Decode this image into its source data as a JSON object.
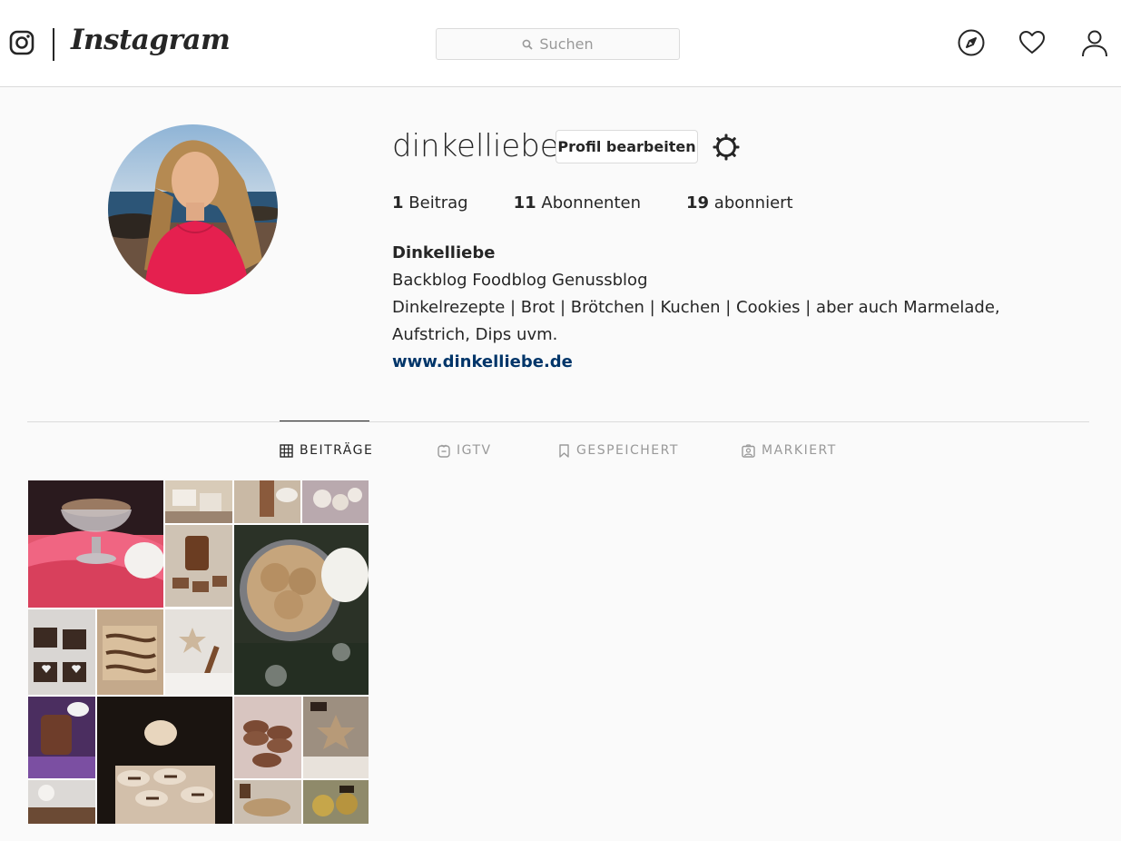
{
  "header": {
    "logo_text": "Instagram",
    "search_placeholder": "Suchen",
    "icons": [
      "instagram-glyph-icon",
      "search-icon",
      "compass-icon",
      "heart-icon",
      "person-icon"
    ]
  },
  "profile": {
    "username": "dinkelliebe",
    "edit_button": "Profil bearbeiten",
    "stats": [
      {
        "count": "1",
        "label": "Beitrag"
      },
      {
        "count": "11",
        "label": "Abonnenten"
      },
      {
        "count": "19",
        "label": "abonniert"
      }
    ],
    "full_name": "Dinkelliebe",
    "bio_line1": "Backblog Foodblog Genussblog",
    "bio_line2": "Dinkelrezepte | Brot | Brötchen | Kuchen | Cookies | aber auch Marmelade, Aufstrich, Dips uvm.",
    "website": "www.dinkelliebe.de"
  },
  "tabs": [
    {
      "label": "BEITRÄGE",
      "icon": "grid-icon",
      "active": true
    },
    {
      "label": "IGTV",
      "icon": "igtv-icon",
      "active": false
    },
    {
      "label": "GESPEICHERT",
      "icon": "bookmark-icon",
      "active": false
    },
    {
      "label": "MARKIERT",
      "icon": "tagged-icon",
      "active": false
    }
  ],
  "colors": {
    "link": "#003569",
    "border": "#dbdbdb",
    "background": "#fafafa",
    "text": "#262626",
    "muted": "#999999"
  }
}
